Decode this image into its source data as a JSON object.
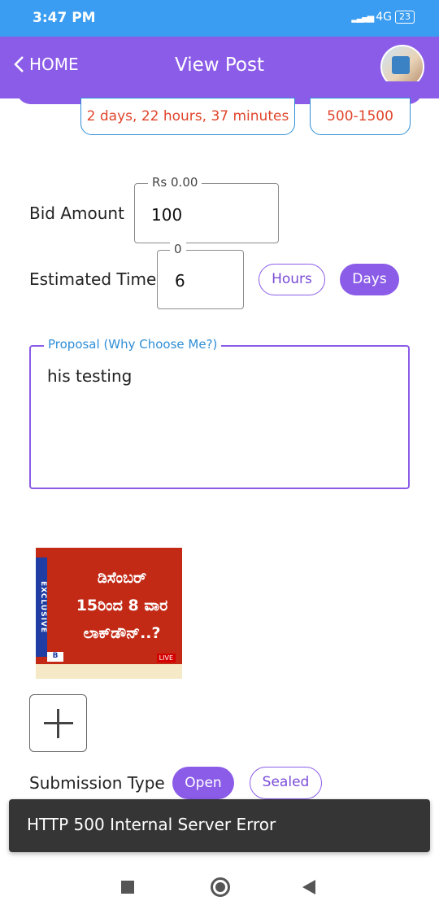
{
  "status_bar": {
    "time": "3:47 PM",
    "network": "4G",
    "battery": "23"
  },
  "app_bar": {
    "back_label": "HOME",
    "title": "View Post"
  },
  "post_info": {
    "time_remaining": "2 days, 22 hours, 37 minutes",
    "budget": "500-1500"
  },
  "bid_amount": {
    "label": "Bid Amount",
    "hint": "Rs 0.00",
    "value": "100"
  },
  "estimated_time": {
    "label": "Estimated Time",
    "hint": "0",
    "value": "6",
    "units": [
      "Hours",
      "Days"
    ],
    "selected_unit": "Days"
  },
  "proposal": {
    "label": "Proposal (Why Choose Me?)",
    "value": "his testing"
  },
  "attachment": {
    "headline_lines": [
      "ಡಿಸೆಂಬರ್",
      "15ರಿಂದ 8 ವಾರ",
      "ಲಾಕ್‌ಡೌನ್..?"
    ],
    "side_text": "EXCLUSIVE",
    "logo_text": "B",
    "live_text": "LIVE"
  },
  "submission_type": {
    "label": "Submission Type",
    "options": [
      "Open",
      "Sealed"
    ],
    "selected": "Open"
  },
  "toast": {
    "message": "HTTP 500 Internal Server Error"
  },
  "colors": {
    "accent": "#8b5ce8",
    "status_bar": "#3a9df1",
    "chip_border": "#2f8fd6",
    "chip_text": "#e0452b",
    "toast_bg": "#353535"
  }
}
